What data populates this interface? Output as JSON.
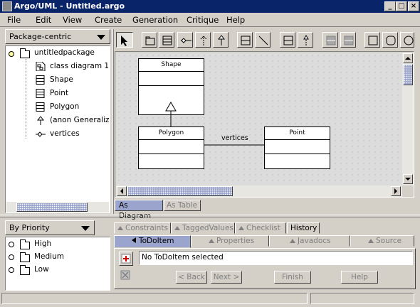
{
  "window": {
    "title": "Argo/UML - Untitled.argo",
    "minimize": "_",
    "maximize": "□",
    "close": "×"
  },
  "menu": [
    "File",
    "Edit",
    "View",
    "Create",
    "Generation",
    "Critique",
    "Help"
  ],
  "navigator": {
    "perspective": "Package-centric",
    "tree": [
      {
        "label": "untitledpackage",
        "icon": "package-icon"
      },
      {
        "label": "class diagram 1",
        "icon": "diagram-icon"
      },
      {
        "label": "Shape",
        "icon": "class-icon"
      },
      {
        "label": "Point",
        "icon": "class-icon"
      },
      {
        "label": "Polygon",
        "icon": "class-icon"
      },
      {
        "label": "(anon Generalizat",
        "icon": "generalization-icon"
      },
      {
        "label": "vertices",
        "icon": "association-icon"
      }
    ]
  },
  "diagram": {
    "classes": {
      "shape": "Shape",
      "polygon": "Polygon",
      "point": "Point"
    },
    "association_label": "vertices",
    "view_tabs": [
      "As Diagram",
      "As Table"
    ]
  },
  "todo": {
    "priority": "By Priority",
    "items": [
      "High",
      "Medium",
      "Low"
    ]
  },
  "details": {
    "tabs_top": [
      "Constraints",
      "TaggedValues",
      "Checklist",
      "History"
    ],
    "tabs_bottom": [
      "ToDoItem",
      "Properties",
      "Javadocs",
      "Source"
    ],
    "message": "No ToDoItem selected",
    "buttons": [
      "< Back",
      "Next >",
      "Finish",
      "Help"
    ]
  },
  "colors": {
    "titlebar": "#0a246a",
    "face": "#d4d0c8",
    "selection": "#9aa4cc"
  }
}
